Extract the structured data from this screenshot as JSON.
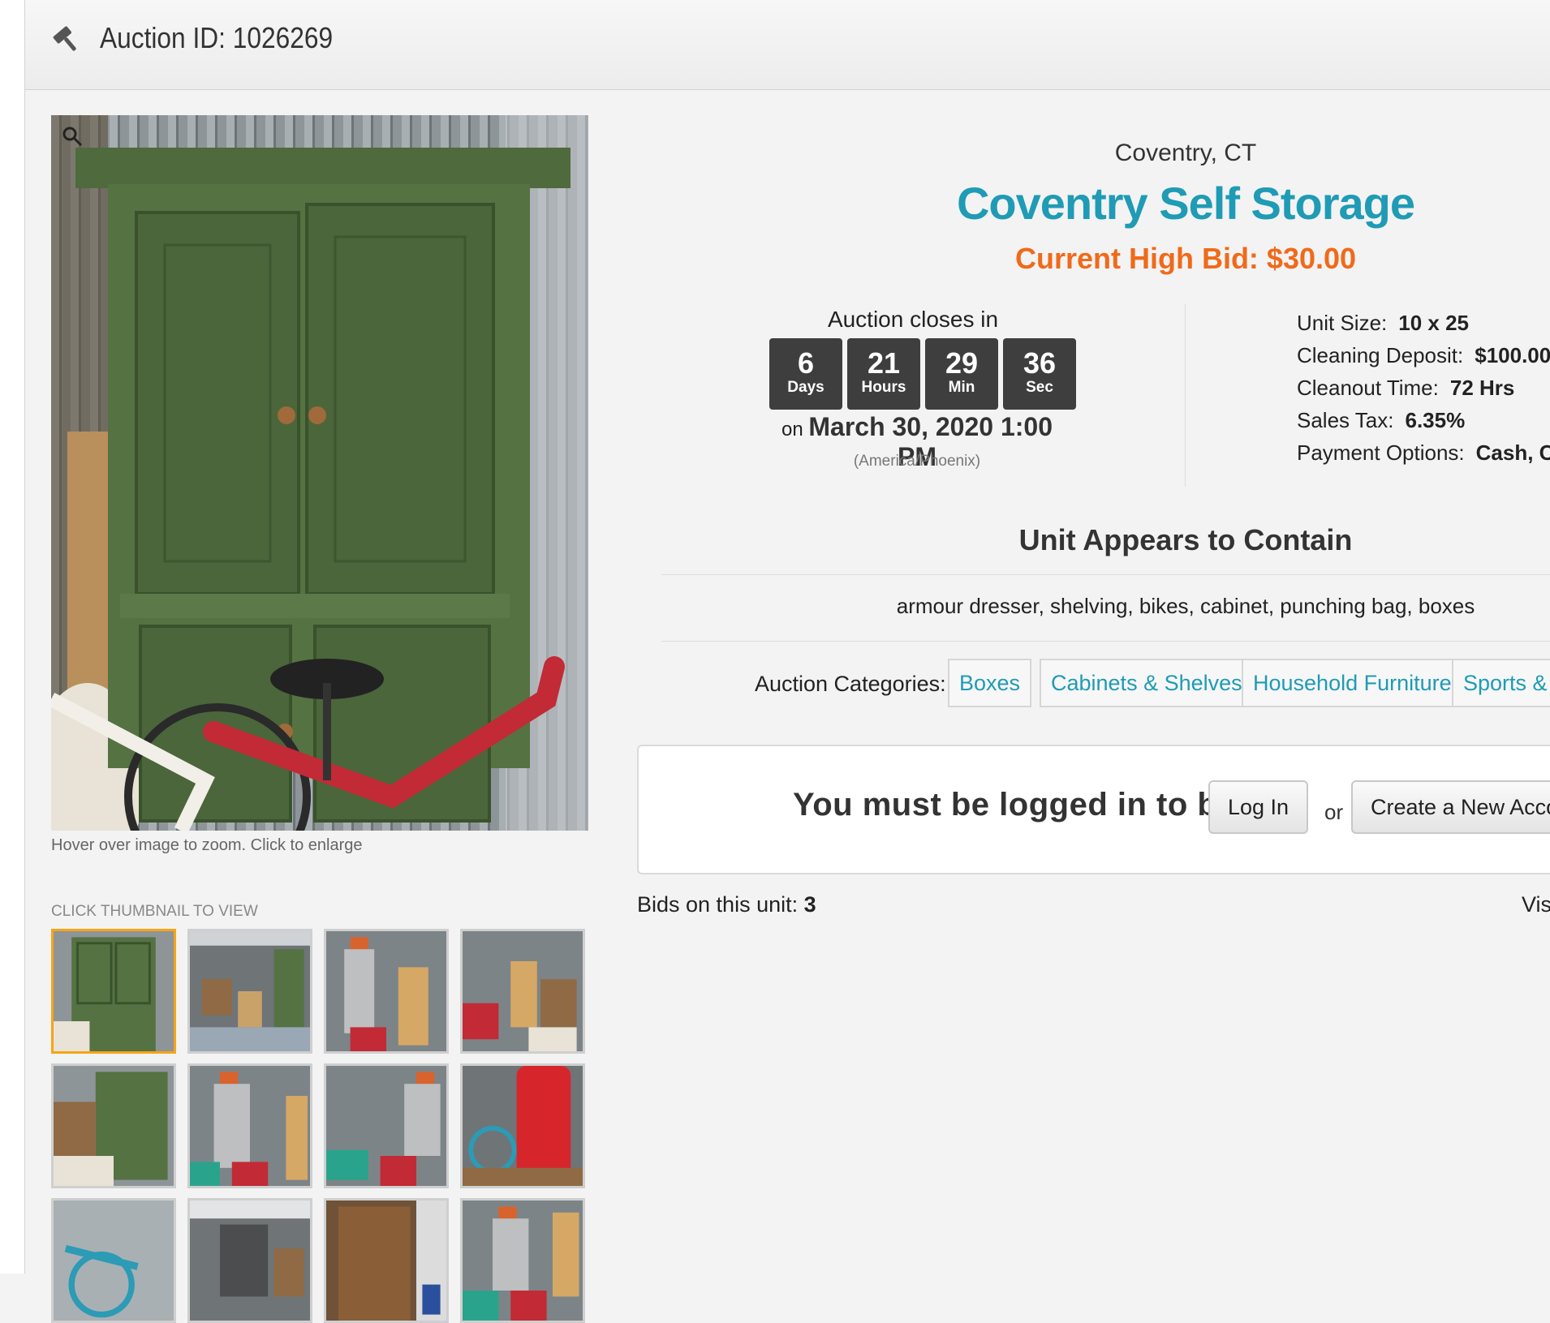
{
  "header": {
    "title": "Auction ID: 1026269",
    "icon": "gavel-icon"
  },
  "gallery": {
    "hint": "Hover over image to zoom. Click to enlarge",
    "thumbs_label": "CLICK THUMBNAIL TO VIEW",
    "thumbnail_count": 12,
    "active_thumbnail": 1
  },
  "facility": {
    "location": "Coventry, CT",
    "name": "Coventry Self Storage",
    "high_bid": "Current High Bid: $30.00"
  },
  "countdown": {
    "label": "Auction closes in",
    "days": "6",
    "days_label": "Days",
    "hours": "21",
    "hours_label": "Hours",
    "min": "29",
    "min_label": "Min",
    "sec": "36",
    "sec_label": "Sec",
    "on": "on",
    "date": "March 30, 2020 1:00 PM",
    "timezone": "(America/Phoenix)"
  },
  "specs": {
    "unit_size_label": "Unit Size:",
    "unit_size": "10 x 25",
    "deposit_label": "Cleaning Deposit:",
    "deposit": "$100.00",
    "cleanout_label": "Cleanout Time:",
    "cleanout": "72 Hrs",
    "tax_label": "Sales Tax:",
    "tax": "6.35%",
    "payment_label": "Payment Options:",
    "payment": "Cash, Cre"
  },
  "contents": {
    "title": "Unit Appears to Contain",
    "items": "armour dresser, shelving, bikes, cabinet, punching bag, boxes"
  },
  "categories": {
    "label": "Auction Categories:",
    "items": [
      "Boxes",
      "Cabinets & Shelves",
      "Household Furniture",
      "Sports & O"
    ]
  },
  "login": {
    "message": "You must be logged in to bid.",
    "login_button": "Log In",
    "or": "or",
    "create_button": "Create a New Accoun"
  },
  "bids": {
    "label": "Bids on this unit:",
    "count": "3",
    "visit": "Visi"
  },
  "colors": {
    "accent": "#1f9bb5",
    "bid": "#f06a1a",
    "active_thumb": "#f7a416",
    "timer_bg": "#3e3e3e"
  }
}
